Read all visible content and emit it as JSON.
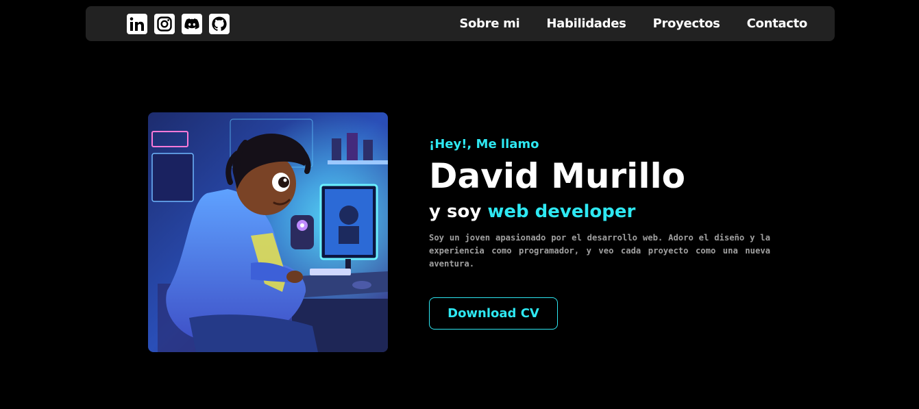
{
  "nav": {
    "socials": [
      {
        "name": "linkedin-icon",
        "glyph": "in"
      },
      {
        "name": "instagram-icon"
      },
      {
        "name": "discord-icon"
      },
      {
        "name": "github-icon"
      }
    ],
    "links": [
      "Sobre mi",
      "Habilidades",
      "Proyectos",
      "Contacto"
    ]
  },
  "hero": {
    "image_alt_subject": "developer-illustration",
    "intro": "¡Hey!, Me llamo",
    "name": "David Murillo",
    "role_prefix": "y soy",
    "role_accent": "web developer",
    "description": "Soy un joven apasionado por el desarrollo web. Adoro el diseño y la experiencia como programador, y veo cada proyecto como una nueva aventura.",
    "cv_button": "Download CV"
  },
  "colors": {
    "background": "#000000",
    "navbar": "#222222",
    "accent": "#2ee8f2",
    "text": "#ffffff",
    "muted": "#a0a0a0"
  }
}
